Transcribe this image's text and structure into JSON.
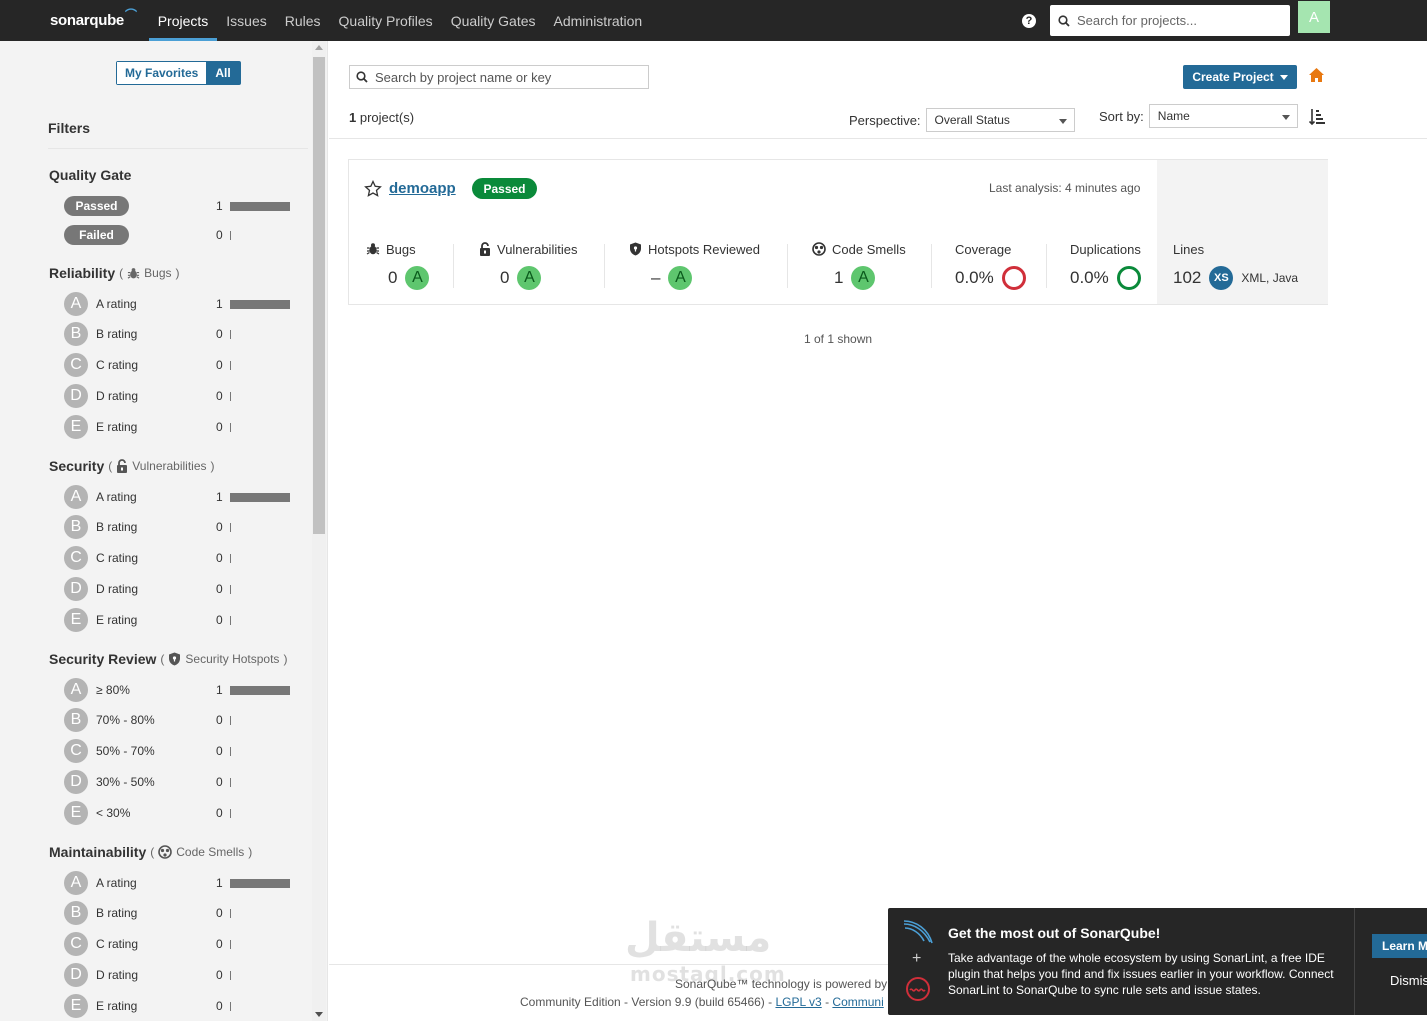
{
  "nav": {
    "brand": "sonarqube",
    "items": [
      "Projects",
      "Issues",
      "Rules",
      "Quality Profiles",
      "Quality Gates",
      "Administration"
    ],
    "active": "Projects",
    "search_placeholder": "Search for projects...",
    "avatar_letter": "A"
  },
  "sidebar": {
    "favorites_label": "My Favorites",
    "all_label": "All",
    "filters_title": "Filters",
    "quality_gate": {
      "title": "Quality Gate",
      "rows": [
        {
          "label": "Passed",
          "count": "1"
        },
        {
          "label": "Failed",
          "count": "0"
        }
      ]
    },
    "reliability": {
      "title": "Reliability",
      "open": "(",
      "sub": "Bugs",
      "close": ")",
      "rows": [
        {
          "grade": "A",
          "label": "A rating",
          "count": "1"
        },
        {
          "grade": "B",
          "label": "B rating",
          "count": "0"
        },
        {
          "grade": "C",
          "label": "C rating",
          "count": "0"
        },
        {
          "grade": "D",
          "label": "D rating",
          "count": "0"
        },
        {
          "grade": "E",
          "label": "E rating",
          "count": "0"
        }
      ]
    },
    "security": {
      "title": "Security",
      "open": "(",
      "sub": "Vulnerabilities",
      "close": ")",
      "rows": [
        {
          "grade": "A",
          "label": "A rating",
          "count": "1"
        },
        {
          "grade": "B",
          "label": "B rating",
          "count": "0"
        },
        {
          "grade": "C",
          "label": "C rating",
          "count": "0"
        },
        {
          "grade": "D",
          "label": "D rating",
          "count": "0"
        },
        {
          "grade": "E",
          "label": "E rating",
          "count": "0"
        }
      ]
    },
    "security_review": {
      "title": "Security Review",
      "open": "(",
      "sub": "Security Hotspots",
      "close": ")",
      "rows": [
        {
          "grade": "A",
          "label": "≥ 80%",
          "count": "1"
        },
        {
          "grade": "B",
          "label": "70% - 80%",
          "count": "0"
        },
        {
          "grade": "C",
          "label": "50% - 70%",
          "count": "0"
        },
        {
          "grade": "D",
          "label": "30% - 50%",
          "count": "0"
        },
        {
          "grade": "E",
          "label": "< 30%",
          "count": "0"
        }
      ]
    },
    "maintainability": {
      "title": "Maintainability",
      "open": "(",
      "sub": "Code Smells",
      "close": ")",
      "rows": [
        {
          "grade": "A",
          "label": "A rating",
          "count": "1"
        },
        {
          "grade": "B",
          "label": "B rating",
          "count": "0"
        },
        {
          "grade": "C",
          "label": "C rating",
          "count": "0"
        },
        {
          "grade": "D",
          "label": "D rating",
          "count": "0"
        },
        {
          "grade": "E",
          "label": "E rating",
          "count": "0"
        }
      ]
    }
  },
  "main": {
    "search_placeholder": "Search by project name or key",
    "create_label": "Create Project",
    "project_count_num": "1",
    "project_count_suffix": "project(s)",
    "perspective_label": "Perspective:",
    "perspective_value": "Overall Status",
    "sortby_label": "Sort by:",
    "sortby_value": "Name",
    "shown": "1 of 1 shown"
  },
  "project": {
    "name": "demoapp",
    "status": "Passed",
    "last_analysis": "Last analysis: 4 minutes ago",
    "metrics": {
      "bugs": {
        "label": "Bugs",
        "value": "0",
        "grade": "A"
      },
      "vulnerabilities": {
        "label": "Vulnerabilities",
        "value": "0",
        "grade": "A"
      },
      "hotspots": {
        "label": "Hotspots Reviewed",
        "value": "–",
        "grade": "A"
      },
      "code_smells": {
        "label": "Code Smells",
        "value": "1",
        "grade": "A"
      },
      "coverage": {
        "label": "Coverage",
        "value": "0.0%"
      },
      "duplications": {
        "label": "Duplications",
        "value": "0.0%"
      },
      "lines": {
        "label": "Lines",
        "value": "102",
        "size": "XS",
        "languages": "XML, Java"
      }
    }
  },
  "footer": {
    "line1": "SonarQube™ technology is powered by",
    "line2_prefix": "Community Edition - Version 9.9 (build 65466) -",
    "lgpl": "LGPL v3",
    "sep": "-",
    "community": "Communi"
  },
  "watermark": {
    "main": "مستقل",
    "small": "mostaql.com"
  },
  "toast": {
    "title": "Get the most out of SonarQube!",
    "body": "Take advantage of the whole ecosystem by using SonarLint, a free IDE plugin that helps you find and fix issues earlier in your workflow. Connect SonarLint to SonarQube to sync rule sets and issue states.",
    "learn": "Learn M",
    "dismiss": "Dismis"
  },
  "colors": {
    "nav_bg": "#262626",
    "accent": "#236a97",
    "passed": "#0a8a3a",
    "grade_a": "#5ec66e",
    "coverage_ring": "#d02f3a",
    "duplication_ring": "#0a8a3a",
    "home": "#e87810"
  }
}
